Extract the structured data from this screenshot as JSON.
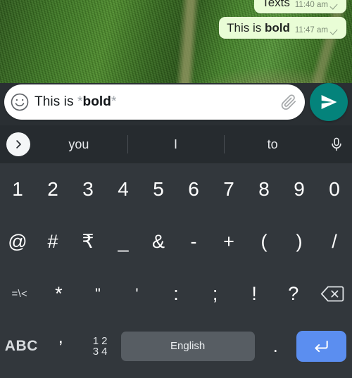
{
  "chat": {
    "messages": [
      {
        "text_plain": "Texts",
        "text_before": "Texts",
        "text_bold": "",
        "text_after": "",
        "time": "11:40 am",
        "status_icon": "single-check-icon"
      },
      {
        "text_plain": "This is bold",
        "text_before": "This is ",
        "text_bold": "bold",
        "text_after": "",
        "time": "11:47 am",
        "status_icon": "single-check-icon"
      }
    ]
  },
  "input_bar": {
    "emoji_icon": "smiley-face-icon",
    "message_before": "This is ",
    "asterisk_open": "*",
    "message_bold": "bold",
    "asterisk_close": "*",
    "attach_icon": "paperclip-icon",
    "send_icon": "send-plane-icon",
    "send_color": "#04837b"
  },
  "suggestions": {
    "expand_icon": "chevron-right-icon",
    "items": [
      "you",
      "I",
      "to"
    ],
    "mic_icon": "microphone-icon"
  },
  "keyboard": {
    "theme_bg": "#32373c",
    "strip_bg": "#262b2f",
    "rows": [
      {
        "name": "numbers",
        "keys": [
          "1",
          "2",
          "3",
          "4",
          "5",
          "6",
          "7",
          "8",
          "9",
          "0"
        ]
      },
      {
        "name": "symbols",
        "keys": [
          "@",
          "#",
          "₹",
          "_",
          "&",
          "-",
          "+",
          "(",
          ")",
          "/"
        ]
      },
      {
        "name": "symbols2",
        "keys": [
          "=\\<",
          "*",
          "\"",
          "'",
          ":",
          ";",
          "!",
          "?"
        ]
      }
    ],
    "backspace_icon": "backspace-icon",
    "bottom": {
      "abc_label": "ABC",
      "comma_label": ",",
      "numeric_grid": [
        "1",
        "2",
        "3",
        "4"
      ],
      "space_label": "English",
      "period_label": ".",
      "enter_icon": "enter-arrow-icon",
      "enter_color": "#5b8ef0"
    }
  }
}
